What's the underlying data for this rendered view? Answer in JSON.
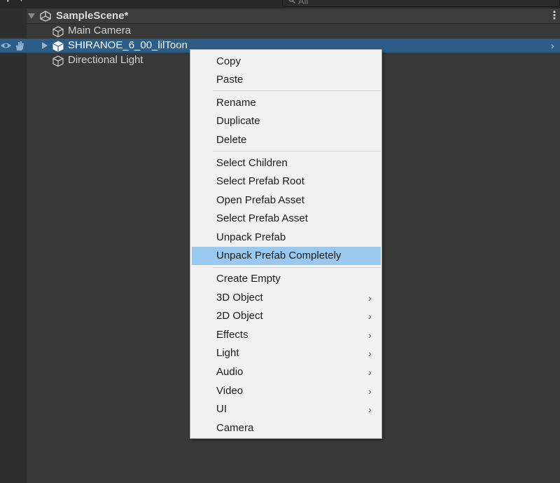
{
  "colors": {
    "background": "#383838",
    "selection": "#2c5d87",
    "menu_bg": "#f2f2f2",
    "menu_highlight": "#99c9ef"
  },
  "toolbar": {
    "add_label": "+",
    "search_placeholder": "All"
  },
  "hierarchy": {
    "scene_name": "SampleScene*",
    "menu_dots": "⋮",
    "items": [
      {
        "label": "Main Camera",
        "icon": "cube-icon"
      },
      {
        "label": "SHIRANOE_6_00_lilToon",
        "icon": "prefab-cube-icon",
        "selected": true
      },
      {
        "label": "Directional Light",
        "icon": "cube-icon"
      }
    ],
    "row_arrow": "›"
  },
  "context_menu": {
    "items": [
      {
        "label": "Copy"
      },
      {
        "label": "Paste"
      },
      {
        "label": "Rename"
      },
      {
        "label": "Duplicate"
      },
      {
        "label": "Delete"
      },
      {
        "label": "Select Children"
      },
      {
        "label": "Select Prefab Root"
      },
      {
        "label": "Open Prefab Asset"
      },
      {
        "label": "Select Prefab Asset"
      },
      {
        "label": "Unpack Prefab"
      },
      {
        "label": "Unpack Prefab Completely",
        "highlighted": true
      },
      {
        "label": "Create Empty"
      },
      {
        "label": "3D Object",
        "submenu": true
      },
      {
        "label": "2D Object",
        "submenu": true
      },
      {
        "label": "Effects",
        "submenu": true
      },
      {
        "label": "Light",
        "submenu": true
      },
      {
        "label": "Audio",
        "submenu": true
      },
      {
        "label": "Video",
        "submenu": true
      },
      {
        "label": "UI",
        "submenu": true
      },
      {
        "label": "Camera"
      }
    ],
    "chevron": "›"
  }
}
